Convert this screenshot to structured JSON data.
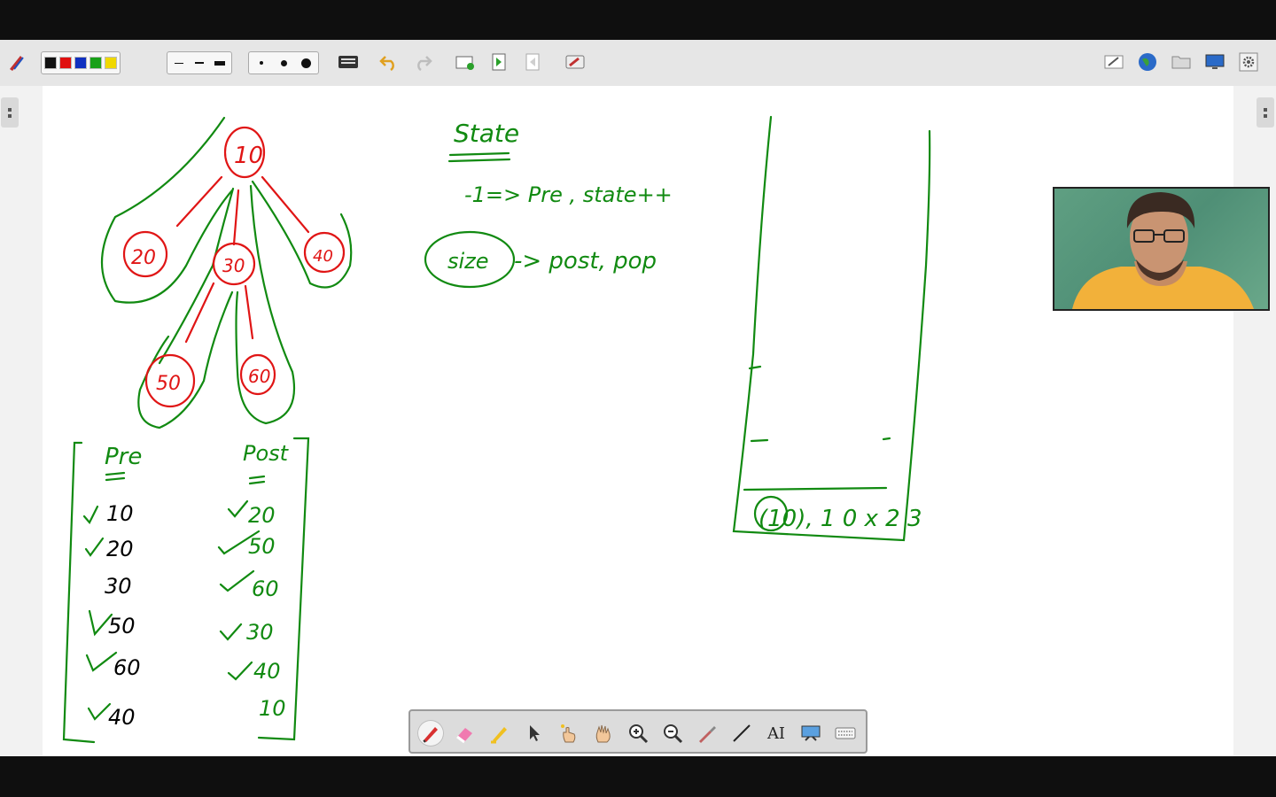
{
  "toolbar": {
    "colors": [
      "#111111",
      "#e01010",
      "#1030c0",
      "#18a018",
      "#f0d800"
    ],
    "line_widths": [
      "thin",
      "medium",
      "thick"
    ],
    "dot_sizes": [
      "small",
      "medium",
      "large"
    ],
    "icons_left": [
      "pen-settings-icon",
      "keyboard-icon",
      "undo-icon",
      "redo-icon",
      "new-page-icon",
      "next-page-icon",
      "prev-page-icon",
      "paint-clear-icon"
    ],
    "icons_right": [
      "edit-icon",
      "globe-icon",
      "folder-icon",
      "screen-icon",
      "settings-icon"
    ]
  },
  "bottom_toolbar": {
    "tools": [
      "pen-icon",
      "eraser-icon",
      "highlighter-icon",
      "pointer-icon",
      "laser-hand-icon",
      "hand-icon",
      "zoom-in-icon",
      "zoom-out-icon",
      "eyedropper-icon",
      "line-icon",
      "text-icon",
      "screen-capture-icon",
      "keyboard-icon"
    ],
    "text_tool_label": "AI"
  },
  "board": {
    "ink_green": "#118a11",
    "ink_red": "#e01515",
    "tree_nodes": [
      "10",
      "20",
      "30",
      "40",
      "50",
      "60"
    ],
    "notes": {
      "state_title": "State",
      "line1": "-1=> Pre , state++",
      "size_word": "size",
      "line2": "-> post, pop"
    },
    "table": {
      "pre_header": "Pre",
      "post_header": "Post",
      "pre_values": [
        "10",
        "20",
        "30",
        "50",
        "60",
        "40"
      ],
      "post_values": [
        "20",
        "50",
        "60",
        "30",
        "40",
        "10"
      ]
    },
    "stack_bottom": "(10), 1 0 x 2 3"
  },
  "webcam": {
    "label": "presenter-video"
  }
}
